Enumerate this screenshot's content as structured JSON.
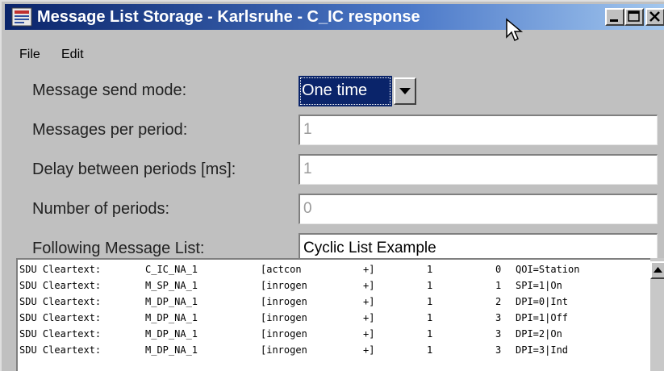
{
  "window": {
    "title": "Message List Storage - Karlsruhe - C_IC response",
    "controls": {
      "minimize_icon": "minimize-icon",
      "maximize_icon": "maximize-icon",
      "close_icon": "close-icon"
    },
    "app_icon": "app-icon",
    "cursor_icon": "mouse-pointer-icon"
  },
  "menu": {
    "file": "File",
    "edit": "Edit"
  },
  "form": {
    "send_mode": {
      "label": "Message send mode:",
      "value": "One time"
    },
    "messages_per_period": {
      "label": "Messages per period:",
      "value": "1"
    },
    "delay_between_periods": {
      "label": "Delay between periods [ms]:",
      "value": "1"
    },
    "number_of_periods": {
      "label": "Number of periods:",
      "value": "0"
    },
    "following_list": {
      "label": "Following Message List:",
      "value": "Cyclic List Example"
    }
  },
  "messages": [
    {
      "prefix": "SDU Cleartext:",
      "type": "C_IC_NA_1",
      "cause": "[actcon",
      "flag": "+]",
      "count": "1",
      "address": "0",
      "value": "QOI=Station"
    },
    {
      "prefix": "SDU Cleartext:",
      "type": "M_SP_NA_1",
      "cause": "[inrogen",
      "flag": "+]",
      "count": "1",
      "address": "1",
      "value": "SPI=1|On"
    },
    {
      "prefix": "SDU Cleartext:",
      "type": "M_DP_NA_1",
      "cause": "[inrogen",
      "flag": "+]",
      "count": "1",
      "address": "2",
      "value": "DPI=0|Int"
    },
    {
      "prefix": "SDU Cleartext:",
      "type": "M_DP_NA_1",
      "cause": "[inrogen",
      "flag": "+]",
      "count": "1",
      "address": "3",
      "value": "DPI=1|Off"
    },
    {
      "prefix": "SDU Cleartext:",
      "type": "M_DP_NA_1",
      "cause": "[inrogen",
      "flag": "+]",
      "count": "1",
      "address": "3",
      "value": "DPI=2|On"
    },
    {
      "prefix": "SDU Cleartext:",
      "type": "M_DP_NA_1",
      "cause": "[inrogen",
      "flag": "+]",
      "count": "1",
      "address": "3",
      "value": "DPI=3|Ind"
    }
  ],
  "scrollbar": {
    "up_icon": "scroll-up-arrow-icon"
  },
  "colors": {
    "title_start": "#0a246a",
    "title_end": "#a6caf0",
    "face": "#c0c0c0",
    "selection": "#0a246a"
  }
}
